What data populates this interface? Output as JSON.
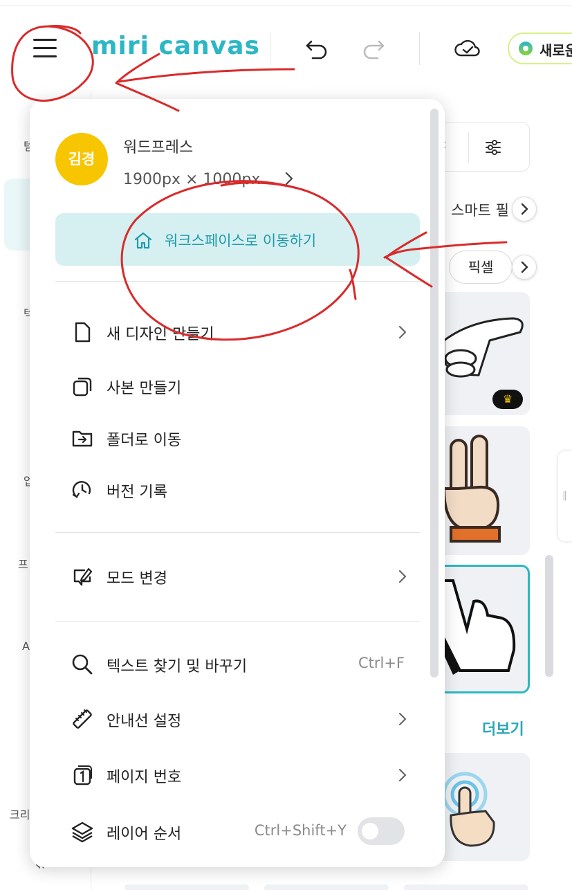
{
  "header": {
    "logo_text": "miri canvas",
    "new_button_label": "새로운",
    "accent_color": "#2bb7c6"
  },
  "left_rail": {
    "chars": [
      "템",
      "텍",
      "업",
      "프",
      "AI",
      "크리"
    ],
    "collapse_icon": "double-chevron-left-icon"
  },
  "right_panel": {
    "smart_label": "스마트 필",
    "pixel_chip": "픽셀",
    "more_link": "더보기",
    "premium_badge": "♛"
  },
  "menu": {
    "avatar_text": "김경",
    "doc_title": "워드프레스",
    "doc_size": "1900px × 1000px",
    "workspace_button": "워크스페이스로 이동하기",
    "items_group1": [
      {
        "label": "새 디자인 만들기",
        "icon": "new-document-icon",
        "has_chevron": true
      },
      {
        "label": "사본 만들기",
        "icon": "copy-icon",
        "has_chevron": false
      },
      {
        "label": "폴더로 이동",
        "icon": "folder-move-icon",
        "has_chevron": false
      },
      {
        "label": "버전 기록",
        "icon": "history-icon",
        "has_chevron": false
      }
    ],
    "items_group2": [
      {
        "label": "모드 변경",
        "icon": "edit-mode-icon",
        "has_chevron": true
      }
    ],
    "items_group3": [
      {
        "label": "텍스트 찾기 및 바꾸기",
        "icon": "search-icon",
        "shortcut": "Ctrl+F"
      },
      {
        "label": "안내선 설정",
        "icon": "ruler-icon",
        "has_chevron": true
      },
      {
        "label": "페이지 번호",
        "icon": "page-number-icon",
        "has_chevron": true
      },
      {
        "label": "레이어 순서",
        "icon": "layers-icon",
        "shortcut": "Ctrl+Shift+Y",
        "toggle_on": false
      }
    ]
  },
  "annotation_color": "#d92b2b"
}
